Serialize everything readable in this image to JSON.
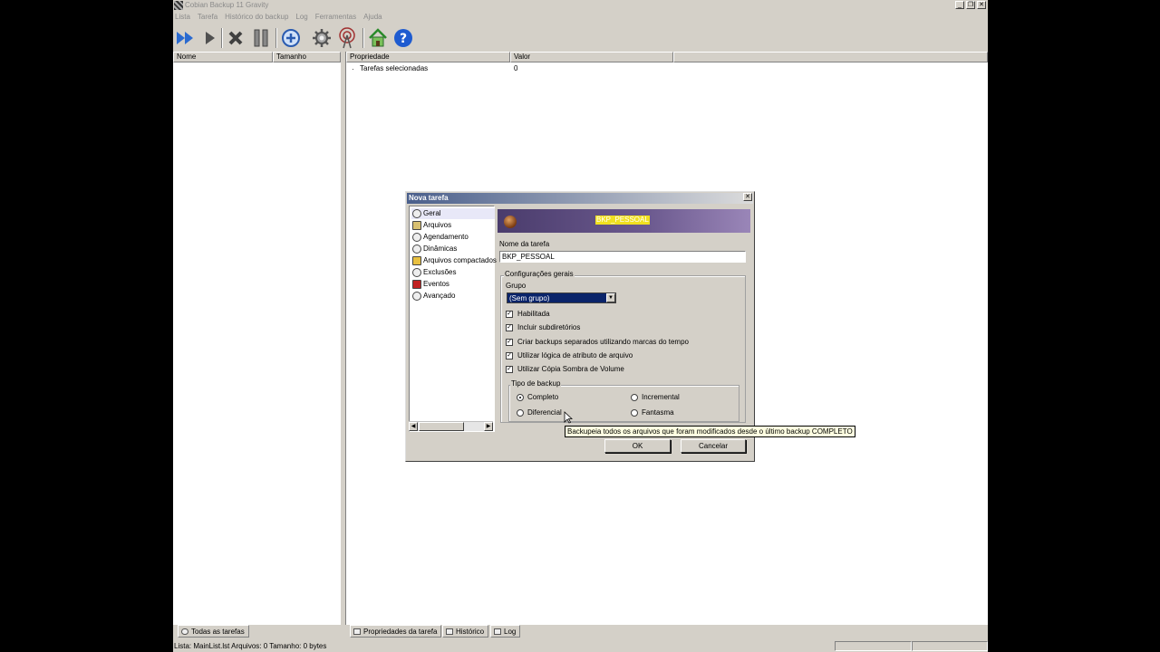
{
  "window": {
    "title": "Cobian Backup 11 Gravity"
  },
  "menu": [
    "Lista",
    "Tarefa",
    "Histórico do backup",
    "Log",
    "Ferramentas",
    "Ajuda"
  ],
  "toolbar": {
    "buttons": [
      "run-all-icon",
      "run-icon",
      "cancel-icon",
      "pause-icon",
      "add-task-icon",
      "settings-icon",
      "antenna-icon",
      "home-icon",
      "help-icon"
    ]
  },
  "task_list": {
    "columns": [
      "Nome",
      "Tamanho"
    ],
    "tab": "Todas as tarefas"
  },
  "properties": {
    "columns": [
      "Propriedade",
      "Valor"
    ],
    "rows": [
      {
        "name": "Tarefas selecionadas",
        "value": "0"
      }
    ],
    "tabs": [
      "Propriedades da tarefa",
      "Histórico",
      "Log"
    ]
  },
  "status": {
    "text": "Lista:  MainList.lst     Arquivos: 0     Tamanho: 0 bytes"
  },
  "dialog": {
    "title": "Nova tarefa",
    "nav": [
      "Geral",
      "Arquivos",
      "Agendamento",
      "Dinâmicas",
      "Arquivos compactados",
      "Exclusões",
      "Eventos",
      "Avançado"
    ],
    "banner_name": "BKP_PESSOAL",
    "task_name_label": "Nome da tarefa",
    "task_name_value": "BKP_PESSOAL",
    "general_settings_label": "Configurações gerais",
    "group_label": "Grupo",
    "group_value": "(Sem grupo)",
    "checks": [
      {
        "label": "Habilitada",
        "checked": true
      },
      {
        "label": "Incluir subdiretórios",
        "checked": true
      },
      {
        "label": "Criar backups separados utilizando marcas do tempo",
        "checked": true
      },
      {
        "label": "Utilizar lógica de atributo de arquivo",
        "checked": true
      },
      {
        "label": "Utilizar Cópia Sombra de Volume",
        "checked": true
      }
    ],
    "backup_type_label": "Tipo de backup",
    "backup_types": [
      {
        "label": "Completo",
        "selected": true
      },
      {
        "label": "Incremental",
        "selected": false
      },
      {
        "label": "Diferencial",
        "selected": false
      },
      {
        "label": "Fantasma",
        "selected": false
      }
    ],
    "ok_label": "OK",
    "cancel_label": "Cancelar",
    "tooltip": "Backupeia todos os arquivos que foram modificados desde o último backup COMPLETO"
  }
}
